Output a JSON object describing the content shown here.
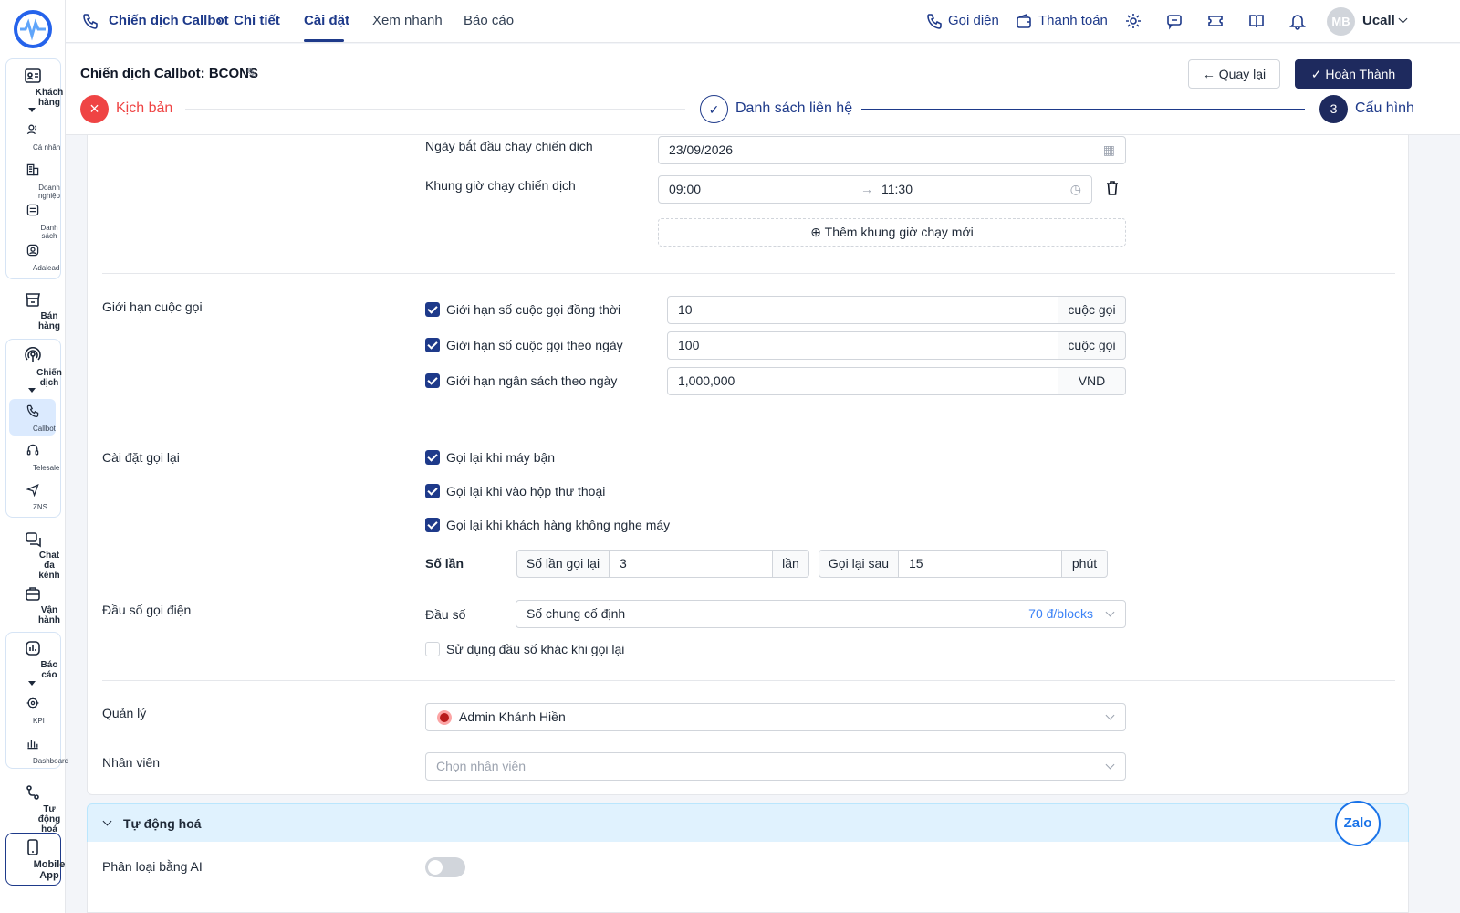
{
  "sidebar": {
    "items": [
      {
        "label": "Khách hàng",
        "icon": "contacts-icon"
      },
      {
        "label": "Cá nhân",
        "icon": "people-icon"
      },
      {
        "label": "Doanh nghiệp",
        "icon": "building-icon"
      },
      {
        "label": "Danh sách",
        "icon": "list-icon"
      },
      {
        "label": "Adalead",
        "icon": "user-circle-icon"
      },
      {
        "label": "Bán hàng",
        "icon": "store-icon"
      },
      {
        "label": "Chiến dịch",
        "icon": "broadcast-icon"
      },
      {
        "label": "Callbot",
        "icon": "phone-icon"
      },
      {
        "label": "Telesale",
        "icon": "headset-icon"
      },
      {
        "label": "ZNS",
        "icon": "send-icon"
      },
      {
        "label": "Chat đa kênh",
        "icon": "chat-icon"
      },
      {
        "label": "Vận hành",
        "icon": "briefcase-icon"
      },
      {
        "label": "Báo cáo",
        "icon": "chart-icon"
      },
      {
        "label": "KPI",
        "icon": "target-icon"
      },
      {
        "label": "Dashboard",
        "icon": "bar-chart-icon"
      },
      {
        "label": "Tự động hoá",
        "icon": "flow-icon"
      },
      {
        "label": "Mobile App",
        "icon": "mobile-icon"
      }
    ]
  },
  "topbar": {
    "breadcrumb": [
      "Chiến dịch Callbot",
      "Chi tiết"
    ],
    "tabs": [
      "Cài đặt",
      "Xem nhanh",
      "Báo cáo"
    ],
    "call_label": "Gọi điện",
    "payment_label": "Thanh toán",
    "avatar_initials": "MB",
    "account_name": "Ucall"
  },
  "header": {
    "title": "Chiến dịch Callbot: BCONS",
    "back_label": "Quay lại",
    "done_label": "Hoàn Thành",
    "steps": [
      {
        "label": "Kịch bản",
        "state": "error"
      },
      {
        "label": "Danh sách liên hệ",
        "state": "done"
      },
      {
        "label": "Cấu hình",
        "state": "current",
        "number": "3"
      }
    ]
  },
  "schedule": {
    "start_date_label": "Ngày bắt đầu chạy chiến dịch",
    "start_date_value": "23/09/2026",
    "time_frame_label": "Khung giờ chạy chiến dịch",
    "time_from": "09:00",
    "time_to": "11:30",
    "add_time_label": "Thêm khung giờ chạy mới"
  },
  "limits": {
    "section_label": "Giới hạn cuộc gọi",
    "rows": [
      {
        "label": "Giới hạn số cuộc gọi đồng thời",
        "value": "10",
        "unit": "cuộc gọi",
        "checked": true
      },
      {
        "label": "Giới hạn số cuộc gọi theo ngày",
        "value": "100",
        "unit": "cuộc gọi",
        "checked": true
      },
      {
        "label": "Giới hạn ngân sách theo ngày",
        "value": "1,000,000",
        "unit": "VND",
        "checked": true
      }
    ]
  },
  "recall": {
    "section_label": "Cài đặt gọi lại",
    "options": [
      {
        "label": "Gọi lại khi máy bận",
        "checked": true
      },
      {
        "label": "Gọi lại khi vào hộp thư thoại",
        "checked": true
      },
      {
        "label": "Gọi lại khi khách hàng không nghe máy",
        "checked": true
      }
    ],
    "count_title": "Số lần",
    "count_label": "Số lần gọi lại",
    "count_value": "3",
    "count_unit": "lần",
    "after_label": "Gọi lại sau",
    "after_value": "15",
    "after_unit": "phút"
  },
  "phone_prefix": {
    "section_label": "Đầu số gọi điện",
    "field_label": "Đầu số",
    "selected": "Số chung cố định",
    "price": "70 đ/blocks",
    "alt_label": "Sử dụng đầu số khác khi gọi lại",
    "alt_checked": false
  },
  "manager": {
    "label": "Quản lý",
    "value": "Admin Khánh Hiền"
  },
  "staff": {
    "label": "Nhân viên",
    "placeholder": "Chọn nhân viên"
  },
  "automation": {
    "title": "Tự động hoá",
    "ai_label": "Phân loại bằng AI",
    "ai_enabled": false
  },
  "zalo_label": "Zalo",
  "colors": {
    "primary": "#1e3a8a",
    "error": "#ef4444",
    "accent_blue": "#3b82f6"
  }
}
